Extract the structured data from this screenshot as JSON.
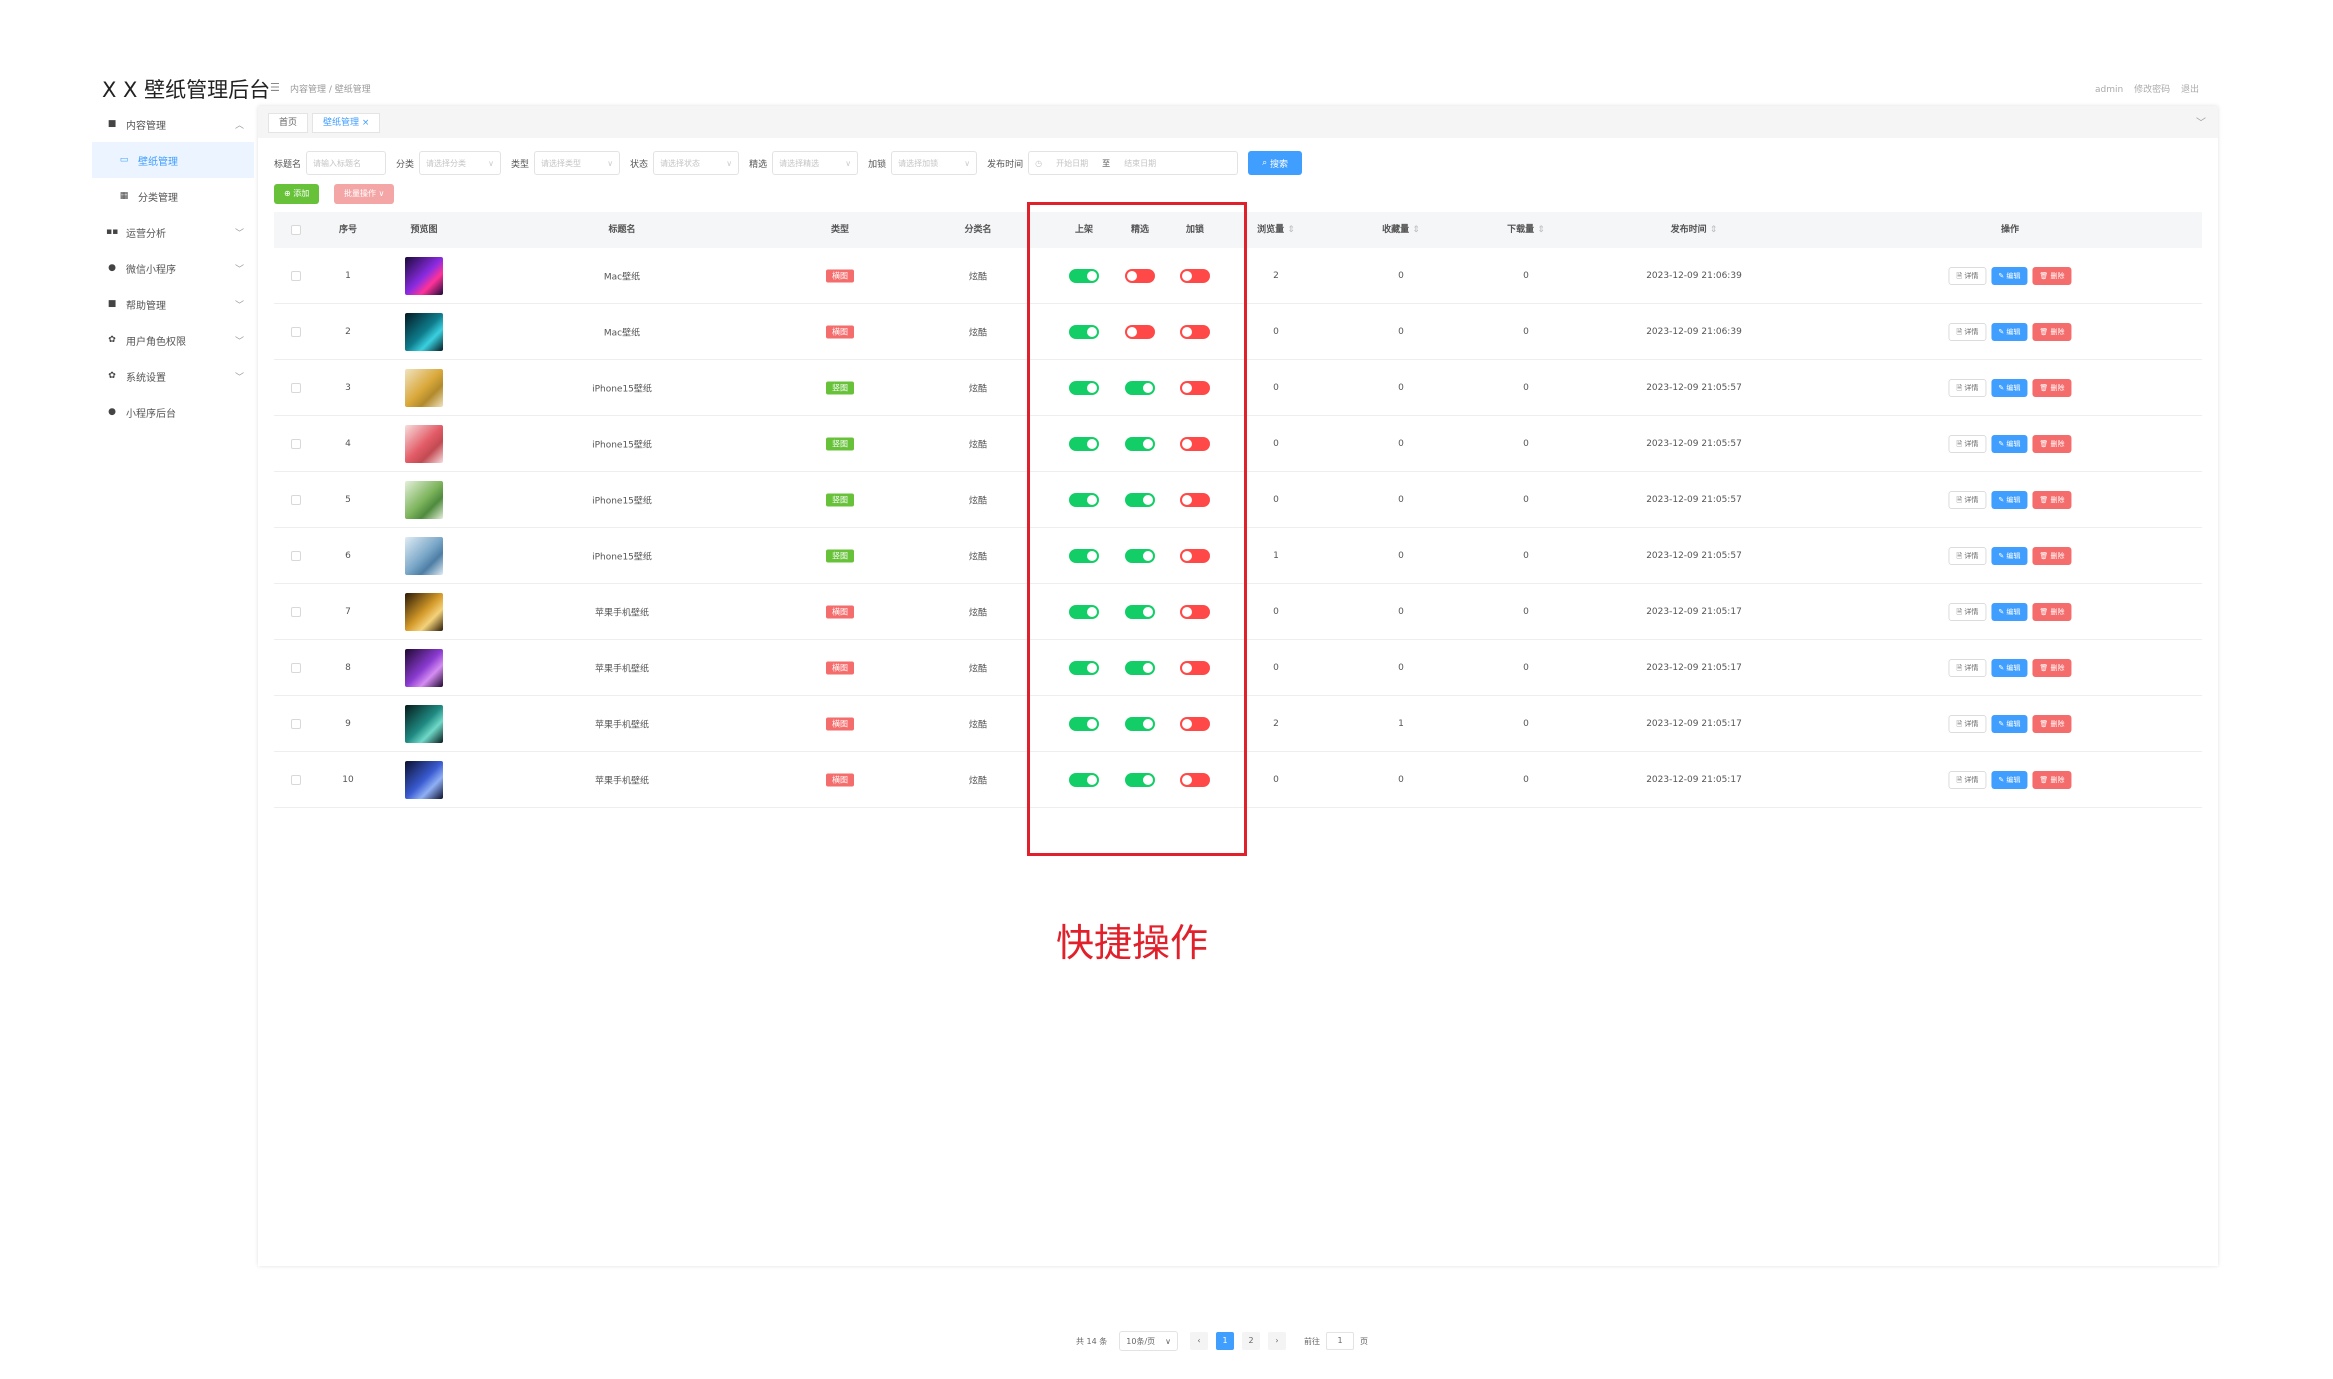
{
  "app": {
    "title": "X X 壁纸管理后台"
  },
  "sidebar": {
    "items": [
      {
        "label": "内容管理",
        "icon": "doc-icon"
      },
      {
        "label": "壁纸管理",
        "icon": "image-icon"
      },
      {
        "label": "分类管理",
        "icon": "grid-icon"
      },
      {
        "label": "运营分析",
        "icon": "apps-icon"
      },
      {
        "label": "微信小程序",
        "icon": "wechat-icon"
      },
      {
        "label": "帮助管理",
        "icon": "doc-icon"
      },
      {
        "label": "用户角色权限",
        "icon": "gear-icon"
      },
      {
        "label": "系统设置",
        "icon": "gear-icon"
      },
      {
        "label": "小程序后台",
        "icon": "wechat-icon"
      }
    ]
  },
  "header": {
    "breadcrumb": [
      "内容管理",
      "壁纸管理"
    ],
    "user": "admin",
    "change_password": "修改密码",
    "logout": "退出"
  },
  "tabs": [
    {
      "label": "首页"
    },
    {
      "label": "壁纸管理"
    }
  ],
  "filters": {
    "title_label": "标题名",
    "title_placeholder": "请输入标题名",
    "category_label": "分类",
    "category_placeholder": "请选择分类",
    "type_label": "类型",
    "type_placeholder": "请选择类型",
    "status_label": "状态",
    "status_placeholder": "请选择状态",
    "featured_label": "精选",
    "featured_placeholder": "请选择精选",
    "lock_label": "加锁",
    "lock_placeholder": "请选择加锁",
    "date_label": "发布时间",
    "date_start": "开始日期",
    "date_sep": "至",
    "date_end": "结束日期",
    "search_button": "搜索"
  },
  "toolbar": {
    "add_label": "添加",
    "batch_label": "批量操作"
  },
  "table": {
    "headers": {
      "index": "序号",
      "preview": "预览图",
      "title": "标题名",
      "type": "类型",
      "category": "分类名",
      "online": "上架",
      "featured": "精选",
      "locked": "加锁",
      "views": "浏览量",
      "favorites": "收藏量",
      "downloads": "下载量",
      "publish_time": "发布时间",
      "actions": "操作"
    },
    "rows": [
      {
        "index": "1",
        "thumb_colors": [
          "#1a0a3a",
          "#8a2be2",
          "#ff3399"
        ],
        "title": "Mac壁纸",
        "type": "横图",
        "type_color": "red",
        "category": "炫酷",
        "online": true,
        "featured": false,
        "locked": false,
        "views": "2",
        "favorites": "0",
        "downloads": "0",
        "time": "2023-12-09 21:06:39"
      },
      {
        "index": "2",
        "thumb_colors": [
          "#031a22",
          "#0e7c8c",
          "#3ad0e0"
        ],
        "title": "Mac壁纸",
        "type": "横图",
        "type_color": "red",
        "category": "炫酷",
        "online": true,
        "featured": false,
        "locked": false,
        "views": "0",
        "favorites": "0",
        "downloads": "0",
        "time": "2023-12-09 21:06:39"
      },
      {
        "index": "3",
        "thumb_colors": [
          "#f0e3c0",
          "#d9a83a",
          "#b28a2c"
        ],
        "title": "iPhone15壁纸",
        "type": "竖图",
        "type_color": "green",
        "category": "炫酷",
        "online": true,
        "featured": true,
        "locked": false,
        "views": "0",
        "favorites": "0",
        "downloads": "0",
        "time": "2023-12-09 21:05:57"
      },
      {
        "index": "4",
        "thumb_colors": [
          "#f7dede",
          "#e35c67",
          "#c24a52"
        ],
        "title": "iPhone15壁纸",
        "type": "竖图",
        "type_color": "green",
        "category": "炫酷",
        "online": true,
        "featured": true,
        "locked": false,
        "views": "0",
        "favorites": "0",
        "downloads": "0",
        "time": "2023-12-09 21:05:57"
      },
      {
        "index": "5",
        "thumb_colors": [
          "#e4f0da",
          "#7db45c",
          "#4f8a3d"
        ],
        "title": "iPhone15壁纸",
        "type": "竖图",
        "type_color": "green",
        "category": "炫酷",
        "online": true,
        "featured": true,
        "locked": false,
        "views": "0",
        "favorites": "0",
        "downloads": "0",
        "time": "2023-12-09 21:05:57"
      },
      {
        "index": "6",
        "thumb_colors": [
          "#e0ecf4",
          "#7aa7c8",
          "#4d7ea5"
        ],
        "title": "iPhone15壁纸",
        "type": "竖图",
        "type_color": "green",
        "category": "炫酷",
        "online": true,
        "featured": true,
        "locked": false,
        "views": "1",
        "favorites": "0",
        "downloads": "0",
        "time": "2023-12-09 21:05:57"
      },
      {
        "index": "7",
        "thumb_colors": [
          "#2a1a05",
          "#d49a2a",
          "#f4d27a"
        ],
        "title": "苹果手机壁纸",
        "type": "横图",
        "type_color": "red",
        "category": "炫酷",
        "online": true,
        "featured": true,
        "locked": false,
        "views": "0",
        "favorites": "0",
        "downloads": "0",
        "time": "2023-12-09 21:05:17"
      },
      {
        "index": "8",
        "thumb_colors": [
          "#1f0830",
          "#8a3bd0",
          "#d58cf2"
        ],
        "title": "苹果手机壁纸",
        "type": "横图",
        "type_color": "red",
        "category": "炫酷",
        "online": true,
        "featured": true,
        "locked": false,
        "views": "0",
        "favorites": "0",
        "downloads": "0",
        "time": "2023-12-09 21:05:17"
      },
      {
        "index": "9",
        "thumb_colors": [
          "#051a1a",
          "#1f8a82",
          "#6fd8c8"
        ],
        "title": "苹果手机壁纸",
        "type": "横图",
        "type_color": "red",
        "category": "炫酷",
        "online": true,
        "featured": true,
        "locked": false,
        "views": "2",
        "favorites": "1",
        "downloads": "0",
        "time": "2023-12-09 21:05:17"
      },
      {
        "index": "10",
        "thumb_colors": [
          "#0a1030",
          "#3a5bd0",
          "#8fb0f5"
        ],
        "title": "苹果手机壁纸",
        "type": "横图",
        "type_color": "red",
        "category": "炫酷",
        "online": true,
        "featured": true,
        "locked": false,
        "views": "0",
        "favorites": "0",
        "downloads": "0",
        "time": "2023-12-09 21:05:17"
      }
    ],
    "action_labels": {
      "detail": "详情",
      "edit": "编辑",
      "delete": "删除"
    }
  },
  "annotation": {
    "caption": "快捷操作"
  },
  "pagination": {
    "total": "共 14 条",
    "page_size": "10条/页",
    "pages": [
      "1",
      "2"
    ],
    "current_page": "1",
    "goto_label": "前往",
    "goto_value": "1",
    "goto_suffix": "页"
  },
  "colors": {
    "primary": "#409eff",
    "success": "#67c23a",
    "danger": "#f56c6c",
    "switch_on": "#13ce66",
    "switch_off": "#ff4949",
    "highlight": "#e0202a"
  }
}
